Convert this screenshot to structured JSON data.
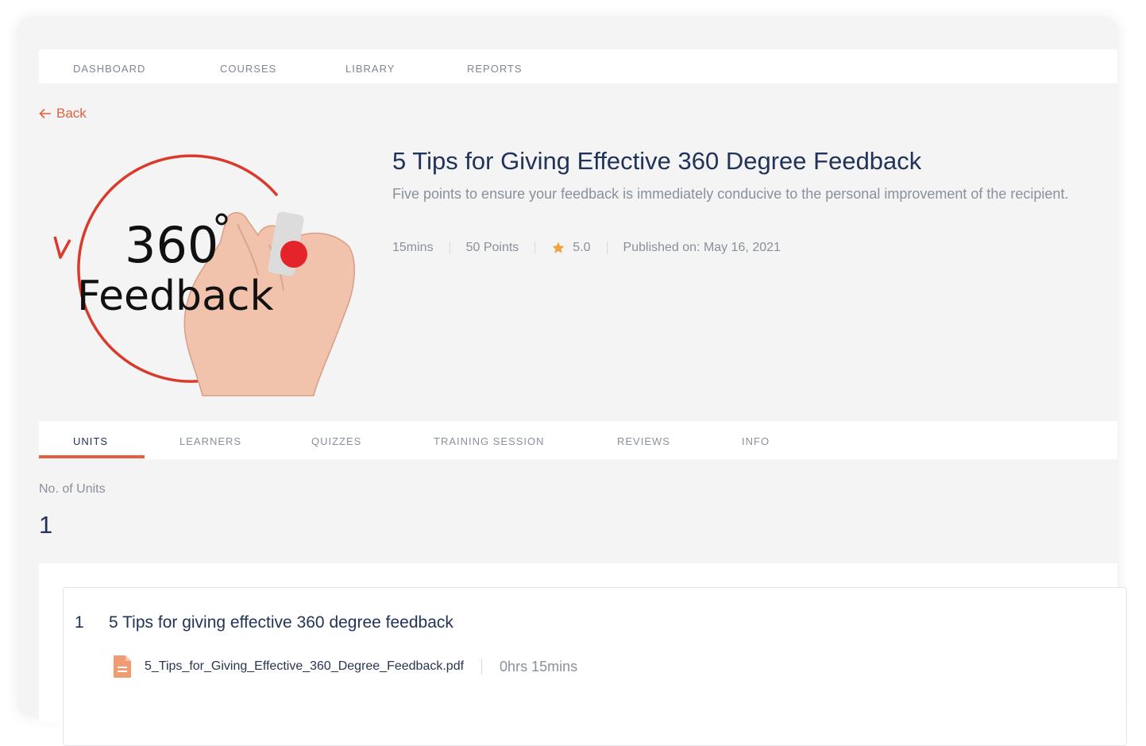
{
  "nav": {
    "items": [
      {
        "label": "DASHBOARD"
      },
      {
        "label": "COURSES"
      },
      {
        "label": "LIBRARY"
      },
      {
        "label": "REPORTS"
      }
    ]
  },
  "back_label": "Back",
  "course": {
    "title": "5 Tips for Giving Effective 360 Degree Feedback",
    "description": "Five points to ensure your feedback is immediately conducive to the personal improvement of the recipient.",
    "duration": "15mins",
    "points": "50 Points",
    "rating": "5.0",
    "published": "Published on: May 16, 2021",
    "image": {
      "number": "360",
      "word": "Feedback"
    }
  },
  "tabs": [
    {
      "label": "UNITS",
      "active": true
    },
    {
      "label": "LEARNERS",
      "active": false
    },
    {
      "label": "QUIZZES",
      "active": false
    },
    {
      "label": "TRAINING SESSION",
      "active": false
    },
    {
      "label": "REVIEWS",
      "active": false
    },
    {
      "label": "INFO",
      "active": false
    }
  ],
  "units": {
    "count_label": "No. of Units",
    "count": "1",
    "items": [
      {
        "number": "1",
        "title": "5 Tips for giving effective 360 degree feedback",
        "file": "5_Tips_for_Giving_Effective_360_Degree_Feedback.pdf",
        "duration": "0hrs 15mins"
      }
    ]
  },
  "colors": {
    "accent": "#e2603f",
    "title": "#22335a",
    "muted": "#8a909b",
    "star": "#f0a140"
  },
  "icons": [
    "back-arrow-icon",
    "star-icon",
    "pdf-file-icon"
  ]
}
